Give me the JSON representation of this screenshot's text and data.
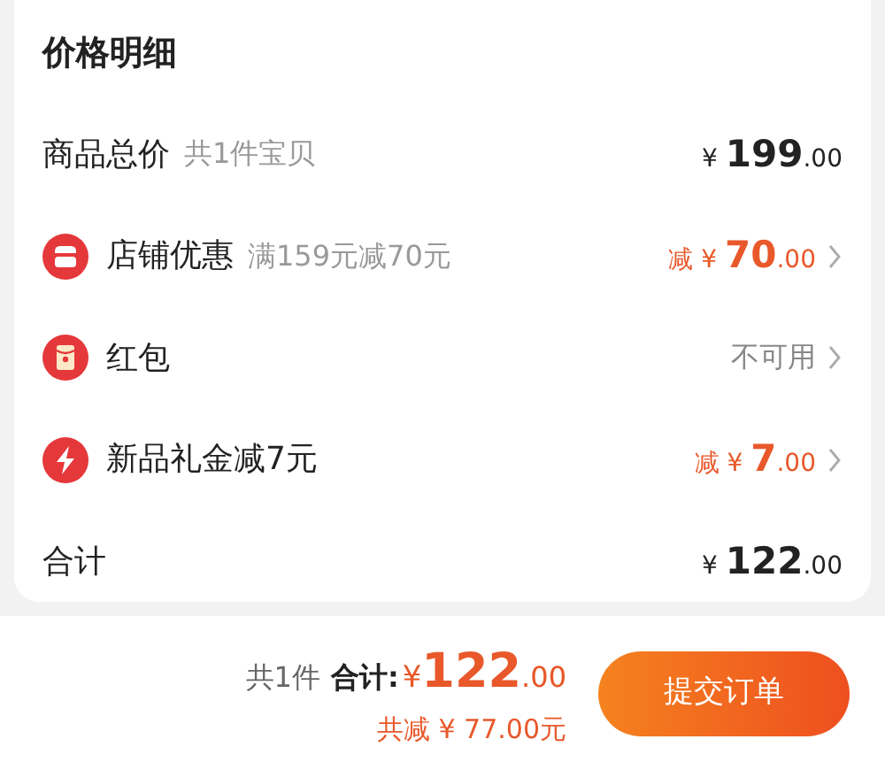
{
  "title": "价格明细",
  "rows": [
    {
      "kind": "plain",
      "label": "商品总价",
      "note": "共1件宝贝",
      "amount": {
        "currency": "¥",
        "integer": "199",
        "decimal": ".00",
        "discount": false
      },
      "has_chevron": false
    },
    {
      "kind": "shop",
      "label": "店铺优惠",
      "note": "满159元减70元",
      "amount": {
        "prefix": "减",
        "currency": "¥",
        "integer": "70",
        "decimal": ".00",
        "discount": true
      },
      "has_chevron": true
    },
    {
      "kind": "packet",
      "label": "红包",
      "status": "不可用",
      "has_chevron": true
    },
    {
      "kind": "bolt",
      "label": "新品礼金减7元",
      "amount": {
        "prefix": "减",
        "currency": "¥",
        "integer": "7",
        "decimal": ".00",
        "discount": true
      },
      "has_chevron": true
    },
    {
      "kind": "plain",
      "label": "合计",
      "amount": {
        "currency": "¥",
        "integer": "122",
        "decimal": ".00",
        "discount": false
      },
      "has_chevron": false
    }
  ],
  "footer": {
    "count": "共1件",
    "total_label": "合计:",
    "currency": "¥",
    "integer": "122",
    "decimal": ".00",
    "saved": "共减 ¥ 77.00元",
    "submit": "提交订单"
  }
}
